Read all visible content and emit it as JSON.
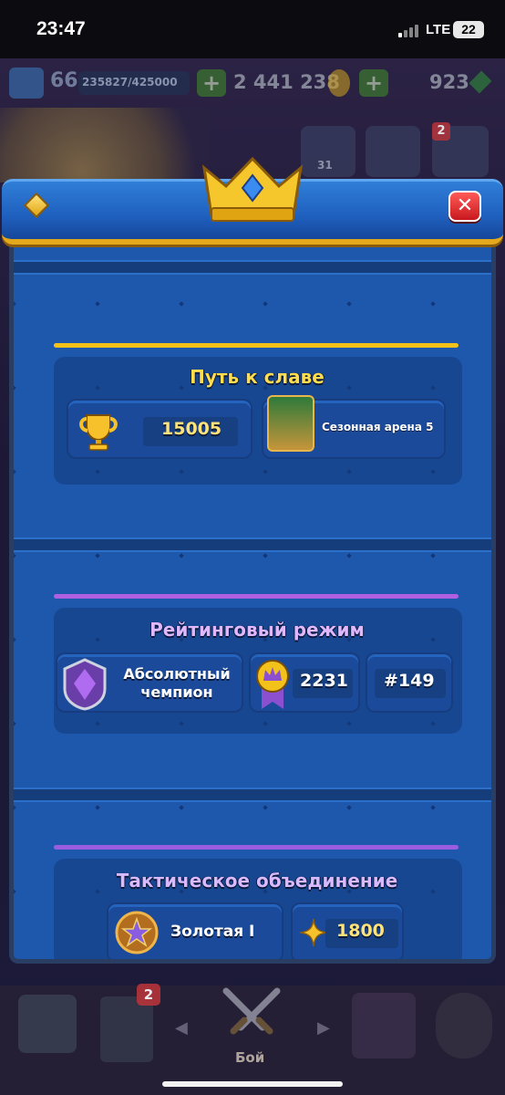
{
  "status_bar": {
    "time": "23:47",
    "network": "LTE",
    "battery": "22"
  },
  "header": {
    "level": "66",
    "xp": "235827/425000",
    "gold": "2 441 238",
    "gems": "923",
    "plus": "+",
    "friends_count": "31",
    "menu_badge": "2"
  },
  "modal": {
    "close_label": "✕",
    "sections": [
      {
        "title": "Путь к славе",
        "trophies": "15005",
        "arena": "Сезонная арена 5",
        "accent": "#f2c21b"
      },
      {
        "title": "Рейтинговый режим",
        "league": "Абсолютный чемпион",
        "rating": "2231",
        "rank": "#149",
        "accent": "#b05fe0"
      },
      {
        "title": "Тактическое объединение",
        "league": "Золотая I",
        "points": "1800",
        "accent": "#9a5de0"
      }
    ]
  },
  "bottom_nav": {
    "cards_badge": "2",
    "battle_label": "Бой",
    "arrow_left": "◀",
    "arrow_right": "▶"
  }
}
